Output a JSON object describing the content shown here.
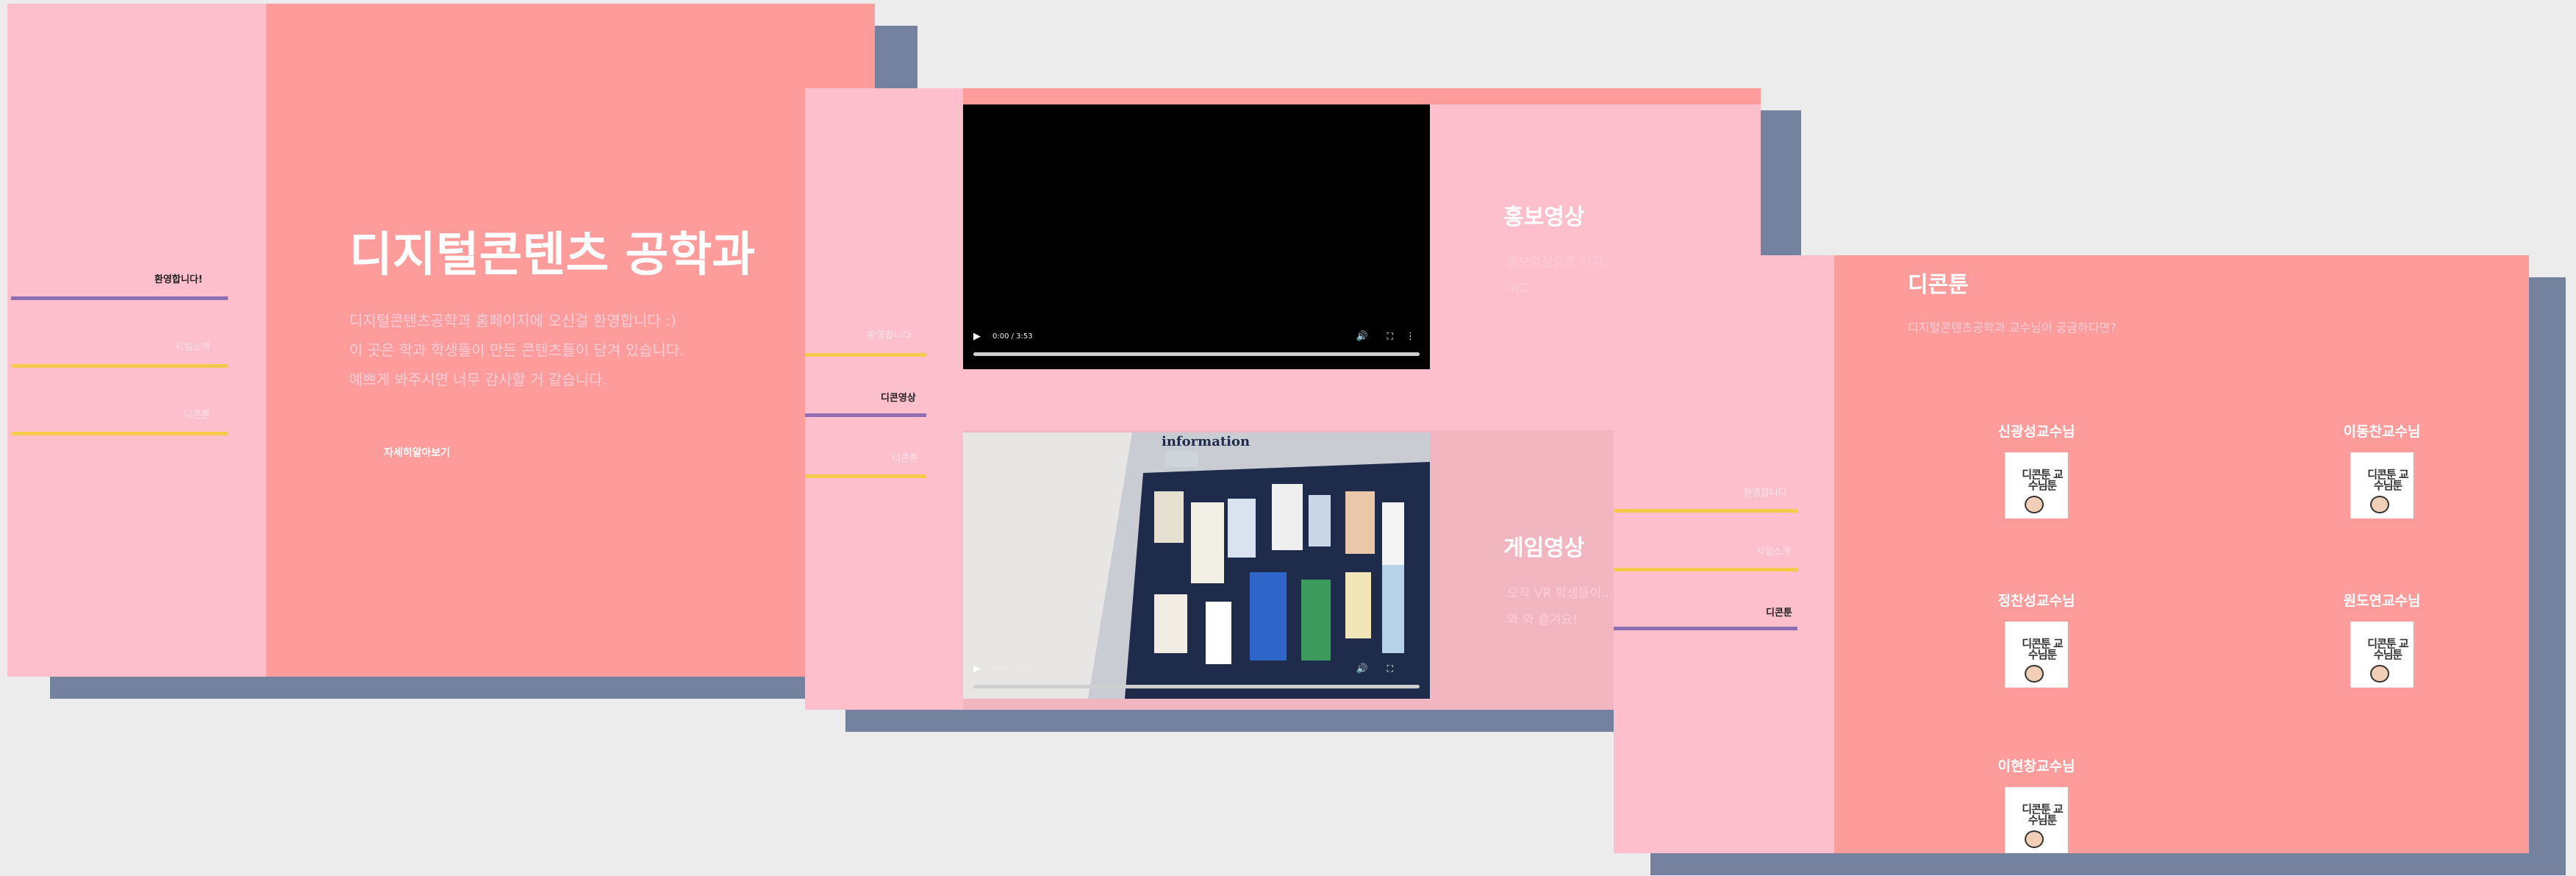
{
  "slide1": {
    "nav": [
      "환영합니다!",
      "시설소개",
      "디콘툰"
    ],
    "title": "디지털콘텐츠 공학과",
    "intro": [
      "디지털콘텐츠공학과 홈페이지에 오신걸 환영합니다 :)",
      "이 곳은 학과 학생들이 만든 콘텐츠들이 담겨 있습니다.",
      "예쁘게 봐주시면 너무 감사할 거 같습니다."
    ],
    "more_link": "자세히알아보기"
  },
  "slide2": {
    "nav": [
      "환영합니다",
      "디콘영상",
      "디콘툰"
    ],
    "video1": {
      "time": "0:00 / 3:53"
    },
    "video2": {
      "time": "0:00 / 2:01",
      "poster_sign": "information"
    },
    "promo": {
      "title": "홍보영상",
      "desc": [
        "홍보영상으로 디지...",
        "이고"
      ]
    },
    "game": {
      "title": "게임영상",
      "desc": [
        "오직 VR 학생들이...",
        "와 와 즐겨요!"
      ]
    }
  },
  "slide3": {
    "nav": [
      "환영합니다",
      "시설소개",
      "디콘툰"
    ],
    "title": "디콘툰",
    "subtitle": "디지털콘텐츠공학과 교수님이 궁금하다면?",
    "professors": [
      "신광성교수님",
      "이동찬교수님",
      "정찬성교수님",
      "원도연교수님",
      "이현창교수님"
    ],
    "thumb_text": "디콘툰 교수님툰"
  },
  "colors": {
    "background": "#ececec",
    "sidebar": "#fdbfcb",
    "main": "#fd9c9b",
    "shadow": "#7482a0",
    "line_purple": "#8e6fb3",
    "line_yellow": "#f5c94a"
  }
}
